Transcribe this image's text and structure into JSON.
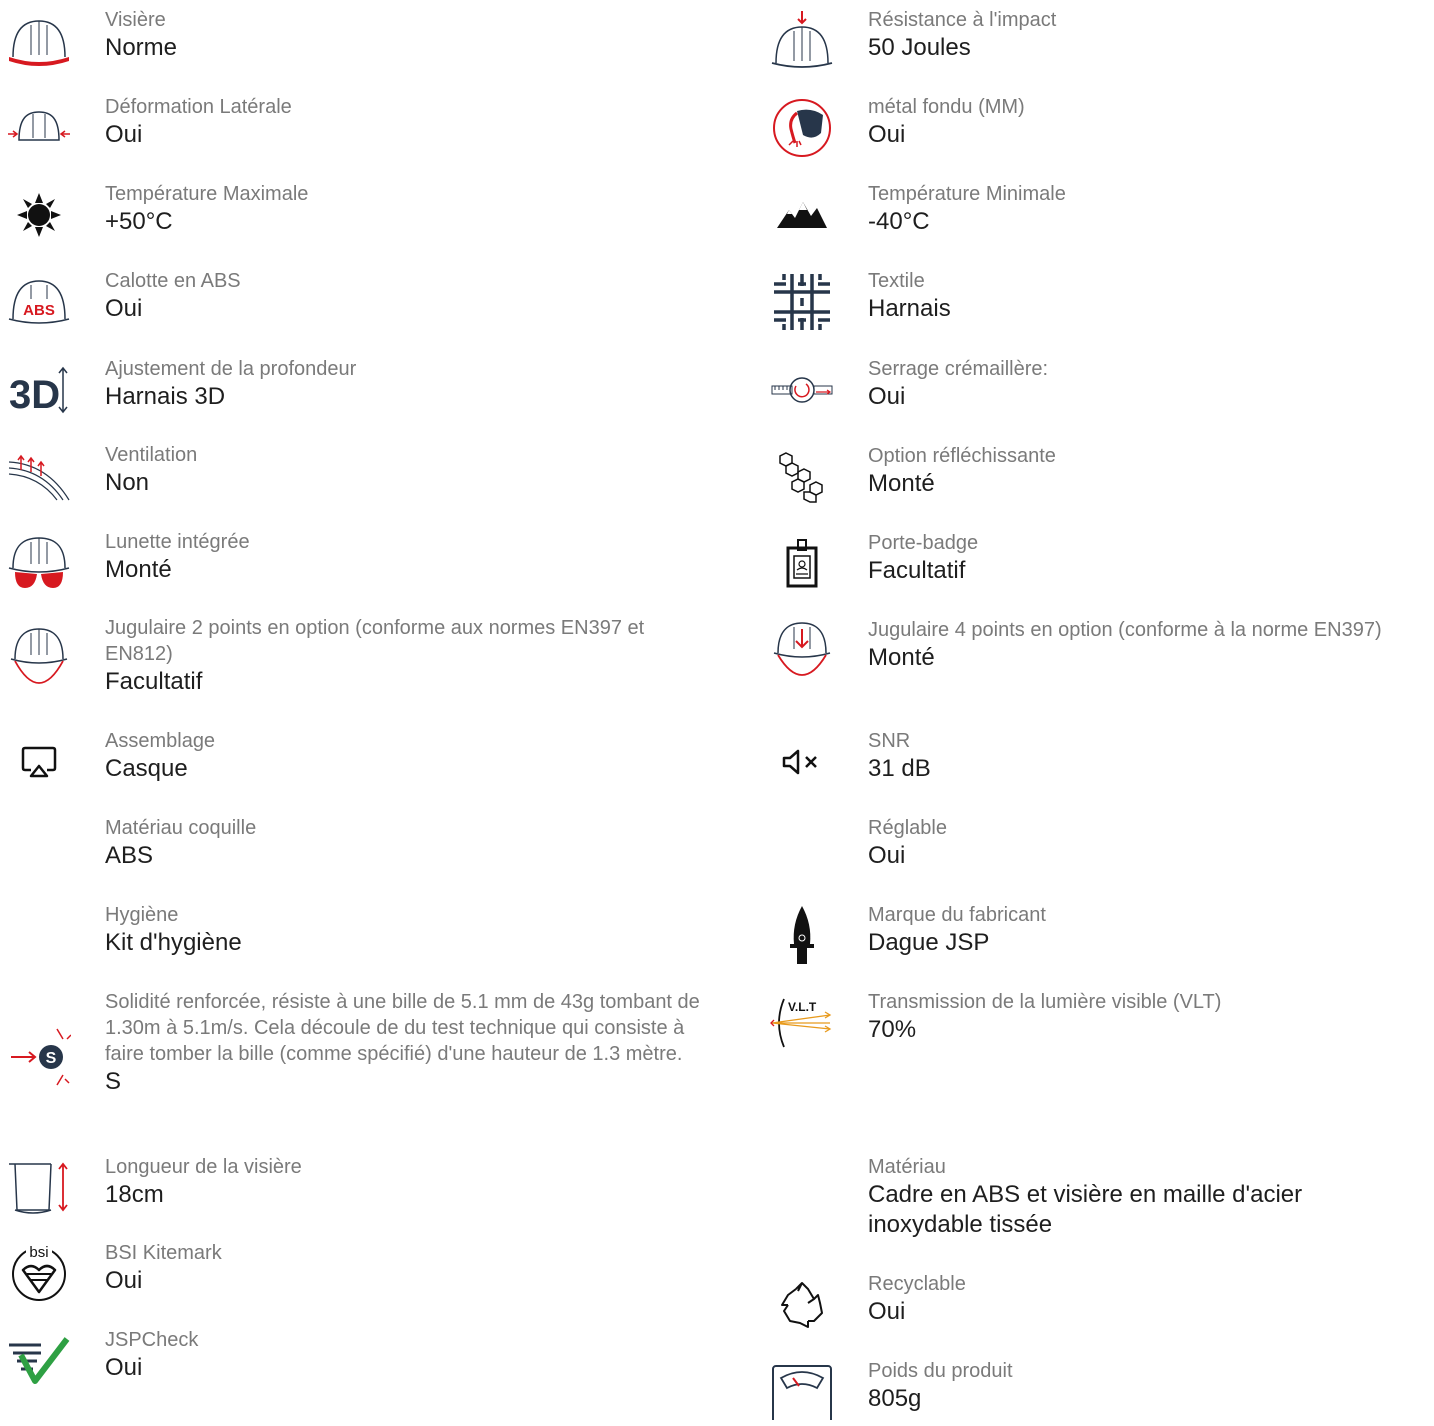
{
  "colors": {
    "accent_red": "#d71920",
    "navy": "#27364a",
    "check_green": "#2ea043",
    "label_gray": "#7a7a7a",
    "value_black": "#1e1e1e"
  },
  "left": [
    {
      "icon": "helmet-red-brim-icon",
      "label": "Visière",
      "value": "Norme"
    },
    {
      "icon": "lateral-deformation-icon",
      "label": "Déformation Latérale",
      "value": "Oui"
    },
    {
      "icon": "sun-icon",
      "label": "Température Maximale",
      "value": "+50°C"
    },
    {
      "icon": "abs-shell-icon",
      "label": "Calotte en ABS",
      "value": "Oui"
    },
    {
      "icon": "3d-depth-icon",
      "label": "Ajustement de la profondeur",
      "value": "Harnais 3D",
      "icon_text": "3D"
    },
    {
      "icon": "ventilation-icon",
      "label": "Ventilation",
      "value": "Non"
    },
    {
      "icon": "integrated-glasses-icon",
      "label": "Lunette intégrée",
      "value": "Monté"
    },
    {
      "icon": "chinstrap-2-point-icon",
      "label": "Jugulaire 2 points en option (conforme aux normes EN397 et EN812)",
      "value": "Facultatif"
    },
    {
      "icon": "assembly-icon",
      "label": "Assemblage",
      "value": "Casque"
    },
    {
      "icon": "",
      "label": "Matériau coquille",
      "value": "ABS"
    },
    {
      "icon": "",
      "label": "Hygiène",
      "value": "Kit d'hygiène"
    },
    {
      "icon": "ball-impact-s-icon",
      "label": "Solidité renforcée, résiste à une bille de 5.1 mm de 43g tombant de 1.30m à 5.1m/s. Cela découle de du test technique qui consiste à faire tomber la bille (comme spécifié) d'une hauteur de 1.3 mètre.",
      "value": "S"
    },
    {
      "icon": "visor-length-icon",
      "label": "Longueur de la visière",
      "value": "18cm"
    },
    {
      "icon": "bsi-kitemark-icon",
      "label": "BSI Kitemark",
      "value": "Oui",
      "icon_text": "bsi"
    },
    {
      "icon": "jspcheck-icon",
      "label": "JSPCheck",
      "value": "Oui"
    }
  ],
  "right": [
    {
      "icon": "impact-resistance-icon",
      "label": "Résistance à l'impact",
      "value": "50 Joules"
    },
    {
      "icon": "molten-metal-icon",
      "label": "métal fondu (MM)",
      "value": "Oui"
    },
    {
      "icon": "mountains-icon",
      "label": "Température Minimale",
      "value": "-40°C"
    },
    {
      "icon": "textile-harness-icon",
      "label": "Textile",
      "value": "Harnais"
    },
    {
      "icon": "ratchet-icon",
      "label": "Serrage crémaillère:",
      "value": "Oui"
    },
    {
      "icon": "reflective-hexagons-icon",
      "label": "Option réfléchissante",
      "value": "Monté"
    },
    {
      "icon": "badge-holder-icon",
      "label": "Porte-badge",
      "value": "Facultatif"
    },
    {
      "icon": "chinstrap-4-point-icon",
      "label": "Jugulaire 4 points en option (conforme à la norme EN397)",
      "value": "Monté"
    },
    {
      "icon": "muted-speaker-icon",
      "label": "SNR",
      "value": "31 dB"
    },
    {
      "icon": "",
      "label": "Réglable",
      "value": "Oui"
    },
    {
      "icon": "dagger-brand-icon",
      "label": "Marque du fabricant",
      "value": "Dague JSP"
    },
    {
      "icon": "vlt-icon",
      "label": "Transmission de la lumière visible (VLT)",
      "value": "70%",
      "icon_text": "V.L.T"
    },
    {
      "icon": "",
      "label": "Matériau",
      "value": "Cadre en ABS et visière en maille d'acier inoxydable tissée"
    },
    {
      "icon": "recycle-icon",
      "label": "Recyclable",
      "value": "Oui"
    },
    {
      "icon": "weight-scale-icon",
      "label": "Poids du produit",
      "value": "805g"
    }
  ]
}
